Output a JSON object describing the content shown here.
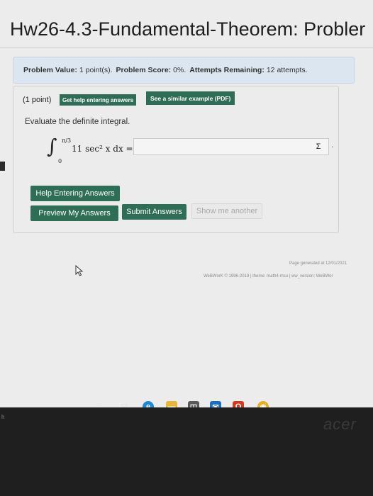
{
  "page": {
    "title": "Hw26-4.3-Fundamental-Theorem: Probler"
  },
  "score_bar": {
    "value_label": "Problem Value:",
    "value": "1 point(s).",
    "score_label": "Problem Score:",
    "score": "0%.",
    "attempts_label": "Attempts Remaining:",
    "attempts": "12 attempts."
  },
  "problem": {
    "points": "(1 point)",
    "help_link": "Get help entering answers",
    "similar_link": "See a similar example (PDF)",
    "prompt": "Evaluate the definite integral.",
    "integral_upper": "π/3",
    "integral_lower": "0",
    "integrand": "11 sec² x dx =",
    "answer_value": "",
    "sigma_label": "Σ",
    "dot_mark": "."
  },
  "buttons": {
    "help": "Help Entering Answers",
    "preview": "Preview My Answers",
    "submit": "Submit Answers",
    "another": "Show me another"
  },
  "footer": {
    "generated": "Page generated at 12/01/2021",
    "copyright": "WeBWorK © 1996-2019 | theme: math4-msu | ww_version: WeBWor"
  },
  "taskbar": {
    "icons": [
      "circle-icon",
      "task-view-icon",
      "edge-icon",
      "file-explorer-icon",
      "store-icon",
      "mail-icon",
      "office-icon",
      "chrome-icon"
    ]
  },
  "monitor": {
    "logo": "acer",
    "corner_char": "h"
  },
  "colors": {
    "accent_green": "#2e6e56",
    "score_bar_bg": "#dbe6f0"
  }
}
